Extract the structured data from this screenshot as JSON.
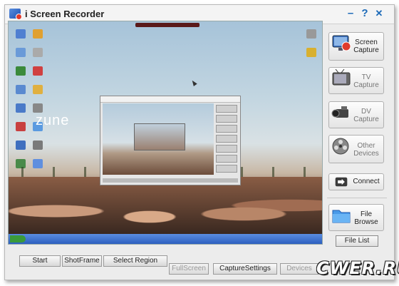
{
  "window": {
    "title": "i Screen Recorder",
    "controls": {
      "minimize": "–",
      "help": "?",
      "close": "✕"
    }
  },
  "preview": {
    "desktop_text": "zune"
  },
  "side_panel": {
    "screen_capture": {
      "label": "Screen Capture",
      "icon": "monitor-record-icon"
    },
    "tv_capture": {
      "label": "TV Capture",
      "icon": "tv-icon"
    },
    "dv_capture": {
      "label": "DV Capture",
      "icon": "camcorder-icon"
    },
    "other_devices": {
      "label": "Other Devices",
      "icon": "film-reel-icon"
    },
    "connect": {
      "label": "Connect",
      "icon": "arrow-right-icon"
    },
    "file_browse": {
      "label": "File Browse",
      "icon": "folder-icon"
    },
    "file_list": "File List"
  },
  "bottom_bar": {
    "start": "Start",
    "shot_frame": "ShotFrame",
    "select_region": "Select Region",
    "full_screen": "FullScreen",
    "capture_settings": "CaptureSettings",
    "devices": "Devices"
  },
  "watermark": "CWER.RU",
  "colors": {
    "accent": "#1c6ab8",
    "record": "#e03a2c"
  }
}
